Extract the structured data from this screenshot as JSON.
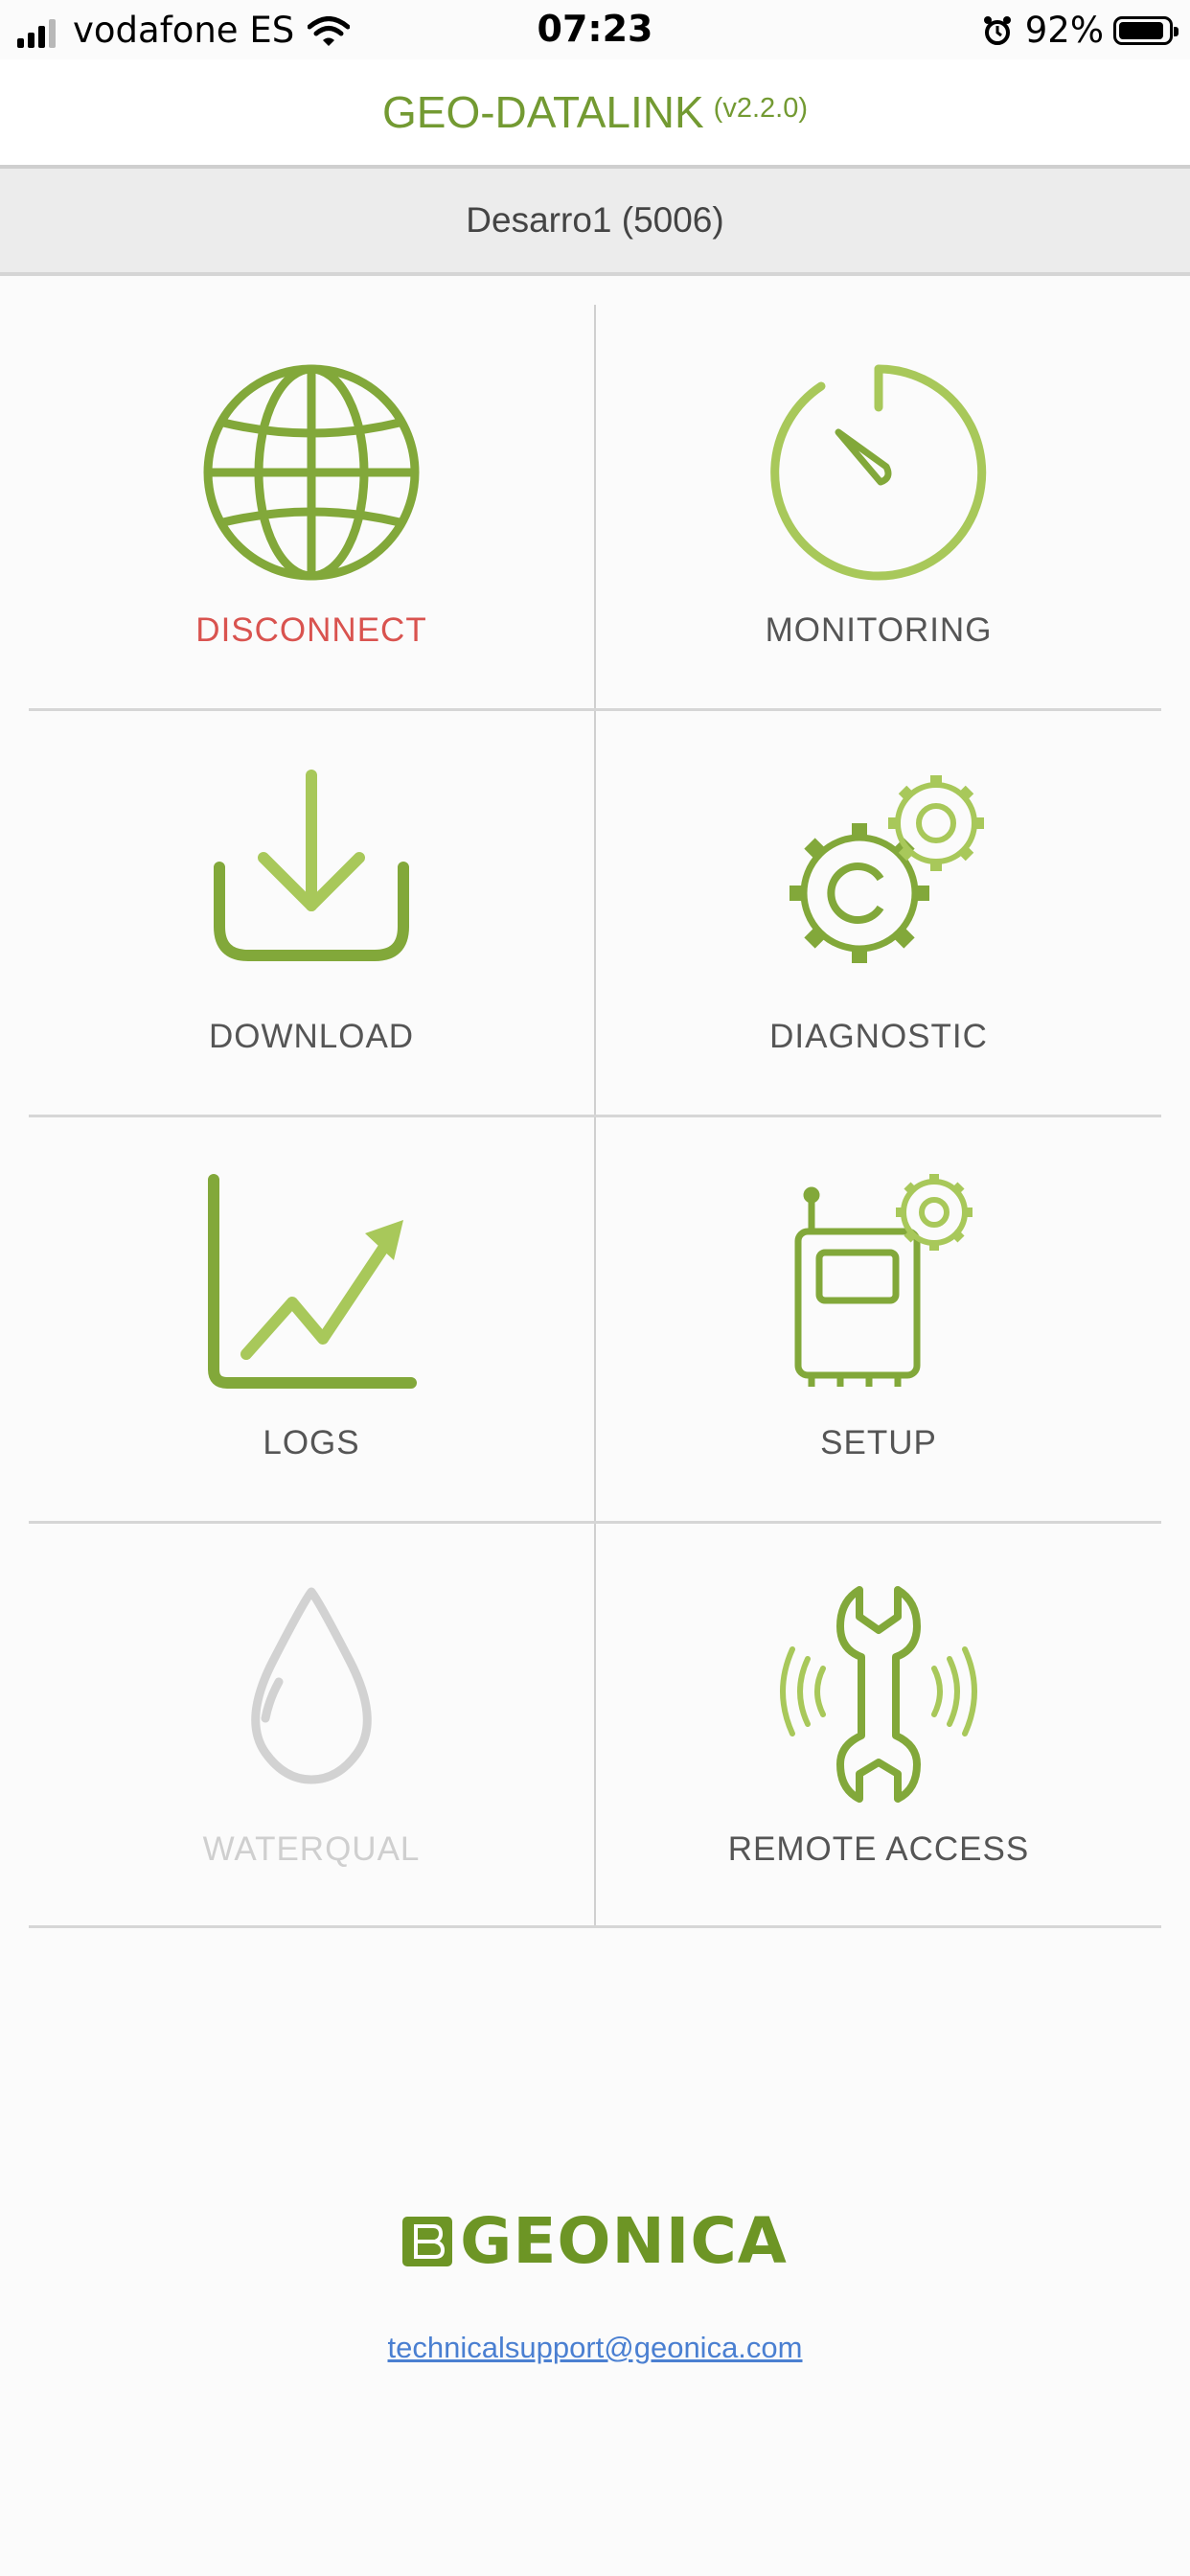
{
  "status_bar": {
    "carrier": "vodafone ES",
    "time": "07:23",
    "battery_percent": "92%",
    "battery_level": 0.92,
    "icons": [
      "signal-icon",
      "wifi-icon",
      "alarm-icon",
      "battery-icon"
    ]
  },
  "header": {
    "title": "GEO-DATALINK",
    "version": "(v2.2.0)"
  },
  "device": {
    "name": "Desarro1 (5006)"
  },
  "tiles": [
    {
      "label": "DISCONNECT",
      "icon": "globe-icon",
      "state": "active-alert",
      "color": "#d9534f"
    },
    {
      "label": "MONITORING",
      "icon": "gauge-icon",
      "state": "normal"
    },
    {
      "label": "DOWNLOAD",
      "icon": "download-icon",
      "state": "normal"
    },
    {
      "label": "DIAGNOSTIC",
      "icon": "gears-icon",
      "state": "normal"
    },
    {
      "label": "LOGS",
      "icon": "chart-trend-icon",
      "state": "normal"
    },
    {
      "label": "SETUP",
      "icon": "device-settings-icon",
      "state": "normal"
    },
    {
      "label": "WATERQUAL",
      "icon": "water-drop-icon",
      "state": "disabled"
    },
    {
      "label": "REMOTE ACCESS",
      "icon": "wrench-signal-icon",
      "state": "normal"
    }
  ],
  "footer": {
    "brand": "GEONICA",
    "support_email": "technicalsupport@geonica.com"
  },
  "colors": {
    "accent": "#739a32",
    "accent_light": "#a8c85a",
    "alert": "#d9534f",
    "disabled": "#cfcfcf",
    "link": "#4a7fd1"
  }
}
